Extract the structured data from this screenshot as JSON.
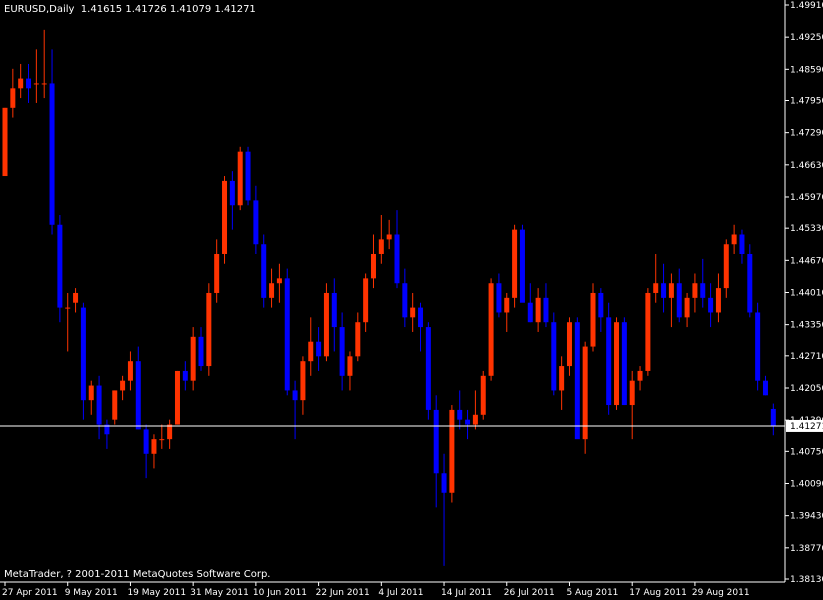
{
  "header": {
    "symbol": "EURUSD,Daily",
    "open": "1.41615",
    "high": "1.41726",
    "low": "1.41079",
    "close": "1.41271"
  },
  "footer": {
    "copyright": "MetaTrader, ? 2001-2011 MetaQuotes Software Corp."
  },
  "colors": {
    "background": "#000000",
    "up_candle": "#FF3300",
    "down_candle": "#0000FF",
    "axis": "#FFFFFF",
    "current_price_line": "#FFFFFF"
  },
  "chart_data": {
    "type": "candlestick",
    "symbol": "EURUSD",
    "timeframe": "Daily",
    "current_price": "1.41271",
    "y_ticks": [
      "1.49910",
      "1.49250",
      "1.48590",
      "1.47950",
      "1.47290",
      "1.46630",
      "1.45970",
      "1.45330",
      "1.44670",
      "1.44010",
      "1.43350",
      "1.42710",
      "1.42050",
      "1.41390",
      "1.40750",
      "1.40090",
      "1.39430",
      "1.38770",
      "1.38130"
    ],
    "ylim": [
      1.3813,
      1.4991
    ],
    "x_ticks": [
      {
        "label": "27 Apr 2011",
        "index": 0
      },
      {
        "label": "9 May 2011",
        "index": 8
      },
      {
        "label": "19 May 2011",
        "index": 16
      },
      {
        "label": "31 May 2011",
        "index": 24
      },
      {
        "label": "10 Jun 2011",
        "index": 32
      },
      {
        "label": "22 Jun 2011",
        "index": 40
      },
      {
        "label": "4 Jul 2011",
        "index": 48
      },
      {
        "label": "14 Jul 2011",
        "index": 56
      },
      {
        "label": "26 Jul 2011",
        "index": 64
      },
      {
        "label": "5 Aug 2011",
        "index": 72
      },
      {
        "label": "17 Aug 2011",
        "index": 80
      },
      {
        "label": "29 Aug 2011",
        "index": 88
      }
    ],
    "candles": [
      [
        1.464,
        1.478,
        1.464,
        1.478
      ],
      [
        1.478,
        1.486,
        1.476,
        1.482
      ],
      [
        1.482,
        1.487,
        1.48,
        1.484
      ],
      [
        1.484,
        1.487,
        1.479,
        1.482
      ],
      [
        1.483,
        1.49,
        1.479,
        1.483
      ],
      [
        1.483,
        1.494,
        1.48,
        1.483
      ],
      [
        1.483,
        1.49,
        1.452,
        1.454
      ],
      [
        1.454,
        1.456,
        1.434,
        1.437
      ],
      [
        1.437,
        1.44,
        1.428,
        1.437
      ],
      [
        1.438,
        1.441,
        1.436,
        1.44
      ],
      [
        1.437,
        1.438,
        1.414,
        1.418
      ],
      [
        1.418,
        1.422,
        1.415,
        1.421
      ],
      [
        1.421,
        1.423,
        1.41,
        1.413
      ],
      [
        1.413,
        1.414,
        1.408,
        1.411
      ],
      [
        1.414,
        1.42,
        1.413,
        1.42
      ],
      [
        1.42,
        1.423,
        1.418,
        1.422
      ],
      [
        1.422,
        1.428,
        1.42,
        1.426
      ],
      [
        1.426,
        1.429,
        1.412,
        1.412
      ],
      [
        1.412,
        1.413,
        1.402,
        1.407
      ],
      [
        1.407,
        1.411,
        1.404,
        1.41
      ],
      [
        1.41,
        1.413,
        1.408,
        1.41
      ],
      [
        1.41,
        1.414,
        1.408,
        1.413
      ],
      [
        1.413,
        1.424,
        1.413,
        1.424
      ],
      [
        1.424,
        1.426,
        1.42,
        1.422
      ],
      [
        1.422,
        1.433,
        1.42,
        1.431
      ],
      [
        1.431,
        1.433,
        1.424,
        1.425
      ],
      [
        1.425,
        1.442,
        1.423,
        1.44
      ],
      [
        1.44,
        1.451,
        1.438,
        1.448
      ],
      [
        1.448,
        1.464,
        1.446,
        1.463
      ],
      [
        1.463,
        1.465,
        1.453,
        1.458
      ],
      [
        1.458,
        1.47,
        1.457,
        1.469
      ],
      [
        1.469,
        1.47,
        1.458,
        1.459
      ],
      [
        1.459,
        1.462,
        1.448,
        1.45
      ],
      [
        1.45,
        1.452,
        1.437,
        1.439
      ],
      [
        1.439,
        1.445,
        1.437,
        1.442
      ],
      [
        1.442,
        1.446,
        1.438,
        1.443
      ],
      [
        1.443,
        1.445,
        1.419,
        1.42
      ],
      [
        1.42,
        1.422,
        1.41,
        1.418
      ],
      [
        1.418,
        1.427,
        1.415,
        1.426
      ],
      [
        1.426,
        1.435,
        1.423,
        1.43
      ],
      [
        1.43,
        1.433,
        1.424,
        1.427
      ],
      [
        1.427,
        1.442,
        1.426,
        1.44
      ],
      [
        1.44,
        1.443,
        1.428,
        1.433
      ],
      [
        1.433,
        1.436,
        1.42,
        1.423
      ],
      [
        1.423,
        1.428,
        1.42,
        1.427
      ],
      [
        1.427,
        1.436,
        1.426,
        1.434
      ],
      [
        1.434,
        1.444,
        1.432,
        1.443
      ],
      [
        1.443,
        1.452,
        1.441,
        1.448
      ],
      [
        1.448,
        1.456,
        1.446,
        1.451
      ],
      [
        1.451,
        1.455,
        1.449,
        1.452
      ],
      [
        1.452,
        1.457,
        1.441,
        1.442
      ],
      [
        1.442,
        1.445,
        1.433,
        1.435
      ],
      [
        1.435,
        1.44,
        1.432,
        1.437
      ],
      [
        1.437,
        1.438,
        1.428,
        1.433
      ],
      [
        1.433,
        1.434,
        1.414,
        1.416
      ],
      [
        1.416,
        1.419,
        1.396,
        1.403
      ],
      [
        1.403,
        1.407,
        1.384,
        1.399
      ],
      [
        1.399,
        1.417,
        1.397,
        1.416
      ],
      [
        1.416,
        1.42,
        1.412,
        1.414
      ],
      [
        1.414,
        1.416,
        1.41,
        1.413
      ],
      [
        1.413,
        1.42,
        1.412,
        1.415
      ],
      [
        1.415,
        1.424,
        1.414,
        1.423
      ],
      [
        1.423,
        1.443,
        1.422,
        1.442
      ],
      [
        1.442,
        1.444,
        1.435,
        1.436
      ],
      [
        1.436,
        1.44,
        1.432,
        1.439
      ],
      [
        1.439,
        1.454,
        1.437,
        1.453
      ],
      [
        1.453,
        1.454,
        1.439,
        1.438
      ],
      [
        1.438,
        1.442,
        1.434,
        1.434
      ],
      [
        1.434,
        1.441,
        1.432,
        1.439
      ],
      [
        1.439,
        1.442,
        1.433,
        1.434
      ],
      [
        1.434,
        1.436,
        1.419,
        1.42
      ],
      [
        1.42,
        1.427,
        1.416,
        1.425
      ],
      [
        1.425,
        1.435,
        1.423,
        1.434
      ],
      [
        1.434,
        1.435,
        1.412,
        1.41
      ],
      [
        1.41,
        1.43,
        1.407,
        1.429
      ],
      [
        1.429,
        1.442,
        1.428,
        1.44
      ],
      [
        1.44,
        1.441,
        1.432,
        1.435
      ],
      [
        1.435,
        1.438,
        1.415,
        1.417
      ],
      [
        1.417,
        1.435,
        1.416,
        1.434
      ],
      [
        1.434,
        1.435,
        1.417,
        1.417
      ],
      [
        1.417,
        1.424,
        1.41,
        1.422
      ],
      [
        1.422,
        1.425,
        1.42,
        1.424
      ],
      [
        1.424,
        1.441,
        1.423,
        1.44
      ],
      [
        1.44,
        1.448,
        1.438,
        1.442
      ],
      [
        1.442,
        1.446,
        1.436,
        1.439
      ],
      [
        1.439,
        1.444,
        1.433,
        1.442
      ],
      [
        1.442,
        1.445,
        1.434,
        1.435
      ],
      [
        1.435,
        1.44,
        1.433,
        1.439
      ],
      [
        1.439,
        1.444,
        1.436,
        1.442
      ],
      [
        1.442,
        1.447,
        1.437,
        1.439
      ],
      [
        1.439,
        1.442,
        1.433,
        1.436
      ],
      [
        1.436,
        1.444,
        1.434,
        1.441
      ],
      [
        1.441,
        1.451,
        1.439,
        1.45
      ],
      [
        1.45,
        1.454,
        1.448,
        1.452
      ],
      [
        1.452,
        1.453,
        1.446,
        1.448
      ],
      [
        1.448,
        1.45,
        1.435,
        1.436
      ],
      [
        1.436,
        1.438,
        1.42,
        1.422
      ],
      [
        1.422,
        1.423,
        1.419,
        1.419
      ],
      [
        1.4162,
        1.4173,
        1.4108,
        1.4127
      ]
    ]
  }
}
